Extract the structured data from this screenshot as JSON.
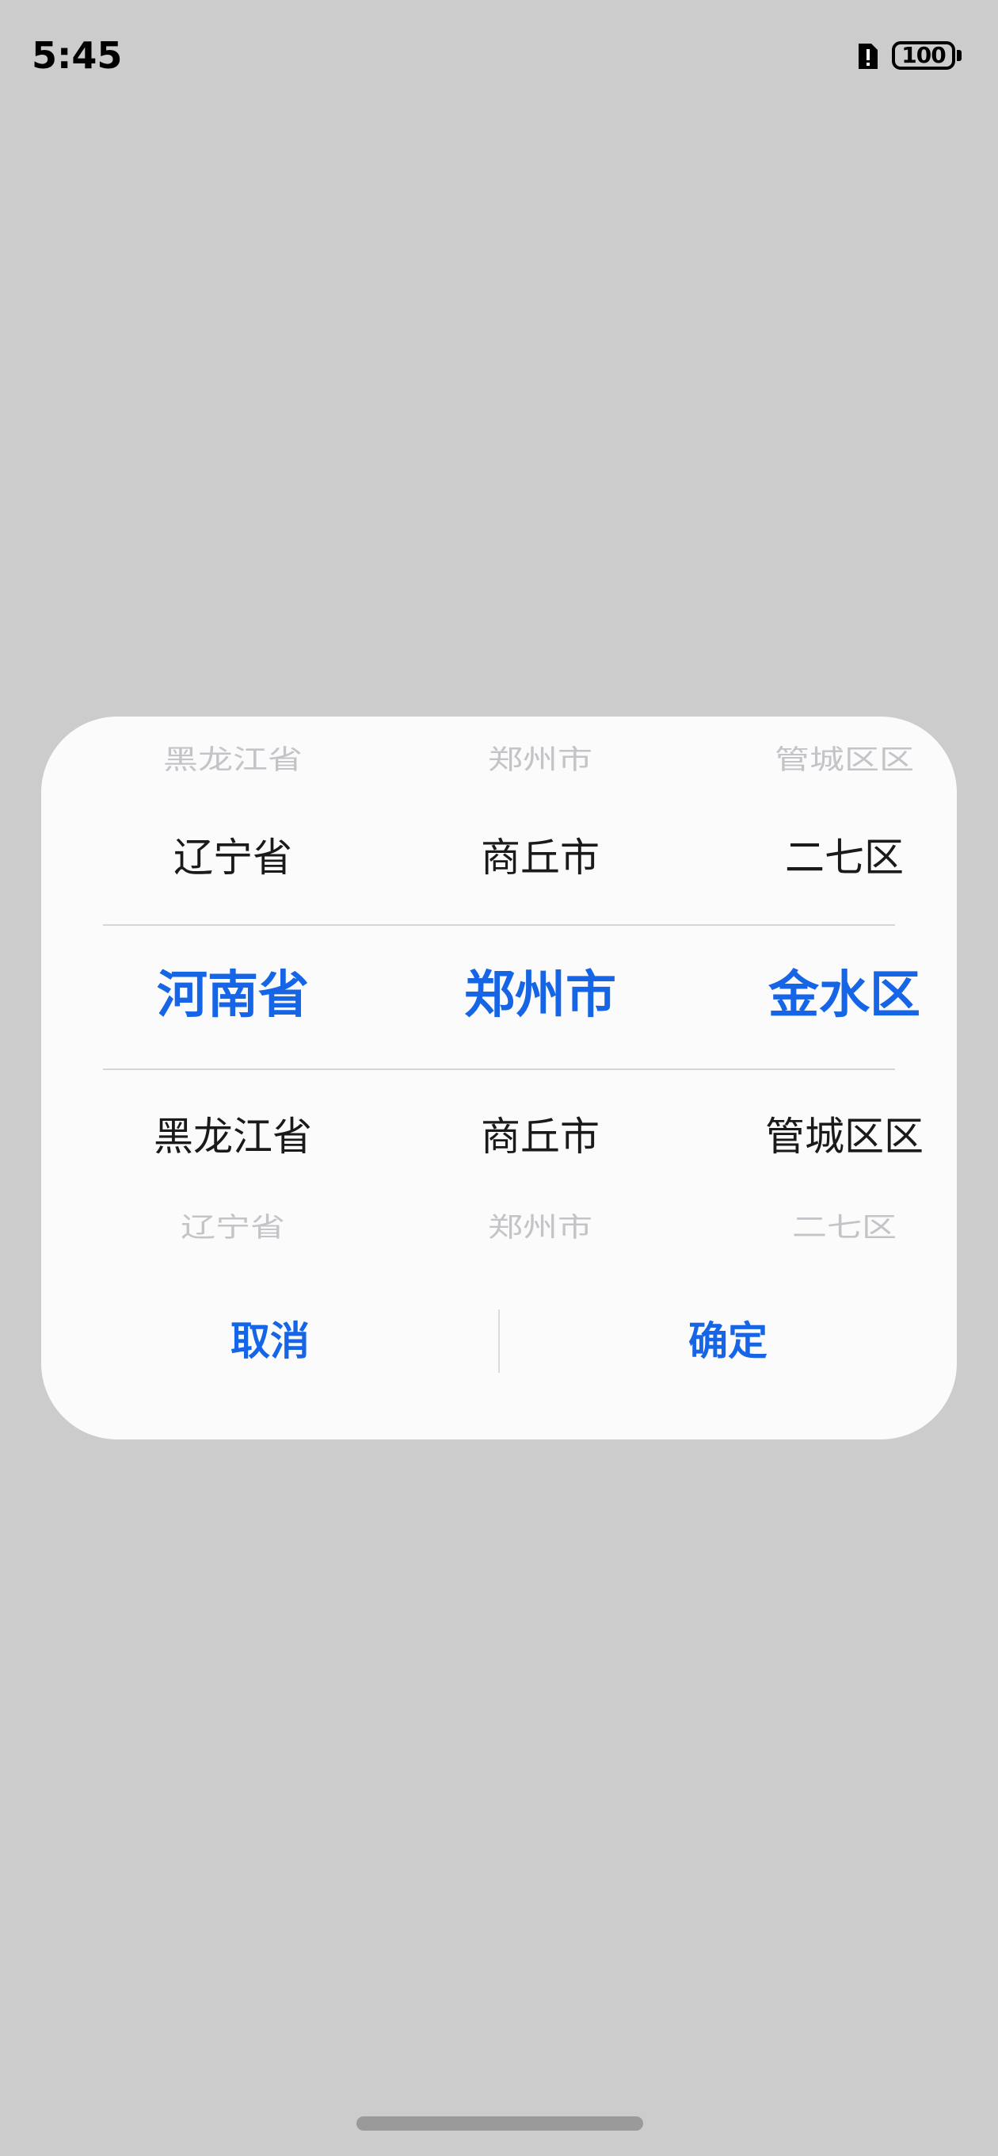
{
  "status_bar": {
    "time": "5:45",
    "battery_level": "100",
    "icons": [
      "sim-alert-icon",
      "battery-icon"
    ]
  },
  "picker": {
    "province": {
      "above_2": "黑龙江省",
      "above_1": "辽宁省",
      "selected": "河南省",
      "below_1": "黑龙江省",
      "below_2": "辽宁省"
    },
    "city": {
      "above_2": "郑州市",
      "above_1": "商丘市",
      "selected": "郑州市",
      "below_1": "商丘市",
      "below_2": "郑州市"
    },
    "district": {
      "above_2": "管城区区",
      "above_1": "二七区",
      "selected": "金水区",
      "below_1": "管城区区",
      "below_2": "二七区"
    }
  },
  "actions": {
    "cancel_label": "取消",
    "confirm_label": "确定"
  },
  "colors": {
    "accent": "#1565e6",
    "backdrop": "#cccccc",
    "dialog_background": "#fbfbfc",
    "faded_text": "#c4c4c8"
  }
}
